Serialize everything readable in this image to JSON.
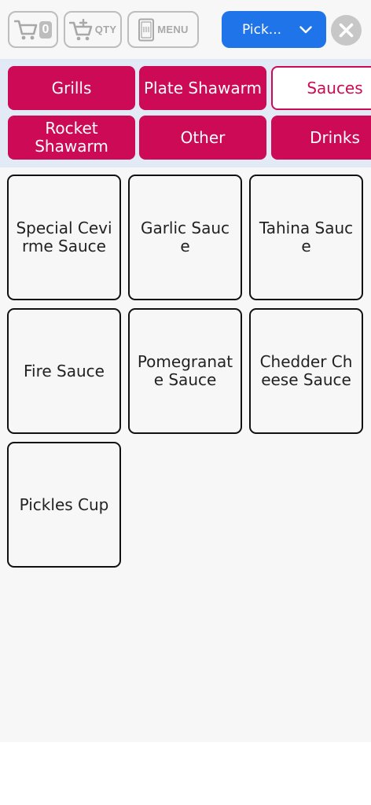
{
  "toolbar": {
    "cart_count": "0",
    "qty_label": "QTY",
    "menu_label": "MENU",
    "order_type_selected": "Pick..."
  },
  "categories": [
    {
      "label": "Grills",
      "active": false
    },
    {
      "label": "Plate Shawarm",
      "active": false
    },
    {
      "label": "Sauces",
      "active": true
    },
    {
      "label": "Rocket Shawarm",
      "active": false
    },
    {
      "label": "Other",
      "active": false
    },
    {
      "label": "Drinks",
      "active": false
    }
  ],
  "products": [
    {
      "label": "Special Cevirme Sauce"
    },
    {
      "label": "Garlic Sauce"
    },
    {
      "label": "Tahina Sauce"
    },
    {
      "label": "Fire Sauce"
    },
    {
      "label": "Pomegranate Sauce"
    },
    {
      "label": "Chedder Cheese Sauce"
    },
    {
      "label": "Pickles Cup"
    }
  ],
  "colors": {
    "accent": "#cc0a55",
    "primary_button": "#1e74e8",
    "category_bg": "#e2eaf6",
    "muted_button": "#bdbdbd"
  },
  "icons": {
    "cart": "cart-icon",
    "add_cart": "add-to-cart-icon",
    "menu": "menu-card-icon",
    "chevron": "chevron-down-icon",
    "close": "close-icon"
  }
}
